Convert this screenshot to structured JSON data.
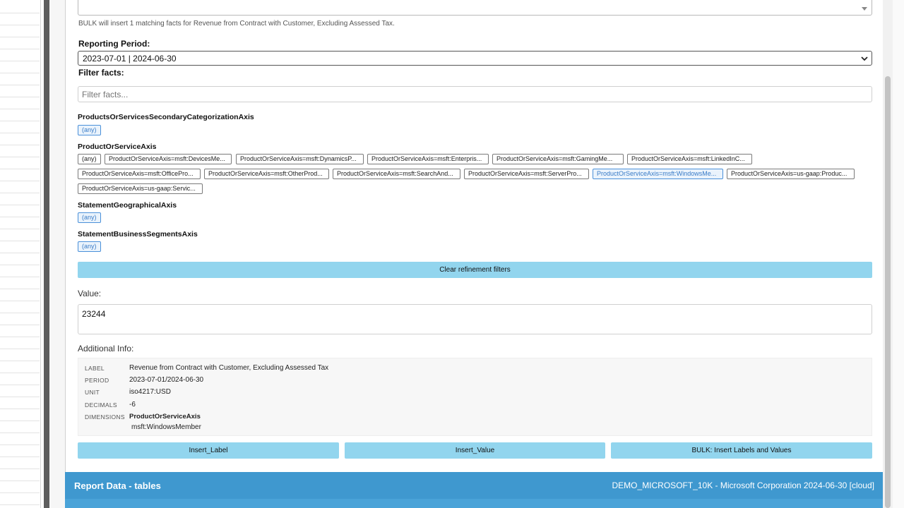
{
  "bulk_note": "BULK will insert 1 matching facts for Revenue from Contract with Customer, Excluding Assessed Tax.",
  "reporting_period": {
    "label": "Reporting Period:",
    "selected": "2023-07-01 | 2024-06-30"
  },
  "filter": {
    "label": "Filter facts:",
    "placeholder": "Filter facts..."
  },
  "axes": [
    {
      "name": "ProductsOrServicesSecondaryCategorizationAxis",
      "members": [
        "(any)"
      ],
      "active_index": 0
    },
    {
      "name": "ProductOrServiceAxis",
      "members": [
        "(any)",
        "ProductOrServiceAxis=msft:DevicesMe...",
        "ProductOrServiceAxis=msft:DynamicsP...",
        "ProductOrServiceAxis=msft:Enterpris...",
        "ProductOrServiceAxis=msft:GamingMe...",
        "ProductOrServiceAxis=msft:LinkedInC...",
        "ProductOrServiceAxis=msft:OfficePro...",
        "ProductOrServiceAxis=msft:OtherProd...",
        "ProductOrServiceAxis=msft:SearchAnd...",
        "ProductOrServiceAxis=msft:ServerPro...",
        "ProductOrServiceAxis=msft:WindowsMe...",
        "ProductOrServiceAxis=us-gaap:Produc...",
        "ProductOrServiceAxis=us-gaap:Servic..."
      ],
      "active_index": 10
    },
    {
      "name": "StatementGeographicalAxis",
      "members": [
        "(any)"
      ],
      "active_index": 0
    },
    {
      "name": "StatementBusinessSegmentsAxis",
      "members": [
        "(any)"
      ],
      "active_index": 0
    }
  ],
  "clear_button": "Clear refinement filters",
  "value": {
    "label": "Value:",
    "text": "23244"
  },
  "additional_info": {
    "label": "Additional Info:",
    "rows": {
      "label_key": "LABEL",
      "label_val": "Revenue from Contract with Customer, Excluding Assessed Tax",
      "period_key": "PERIOD",
      "period_val": "2023-07-01/2024-06-30",
      "unit_key": "UNIT",
      "unit_val": "iso4217:USD",
      "decimals_key": "DECIMALS",
      "decimals_val": "-6",
      "dimensions_key": "DIMENSIONS",
      "dimensions_axis": "ProductOrServiceAxis",
      "dimensions_member": "msft:WindowsMember"
    }
  },
  "buttons": {
    "insert_label": "Insert_Label",
    "insert_value": "Insert_Value",
    "bulk": "BULK: Insert Labels and Values"
  },
  "report_bar": {
    "title": "Report Data - tables",
    "source": "DEMO_MICROSOFT_10K - Microsoft Corporation 2024-06-30 [cloud]"
  },
  "colors": {
    "accent_button": "#92d5ee",
    "report_bar": "#3f98cf",
    "active_chip": "#3a7cc7"
  }
}
